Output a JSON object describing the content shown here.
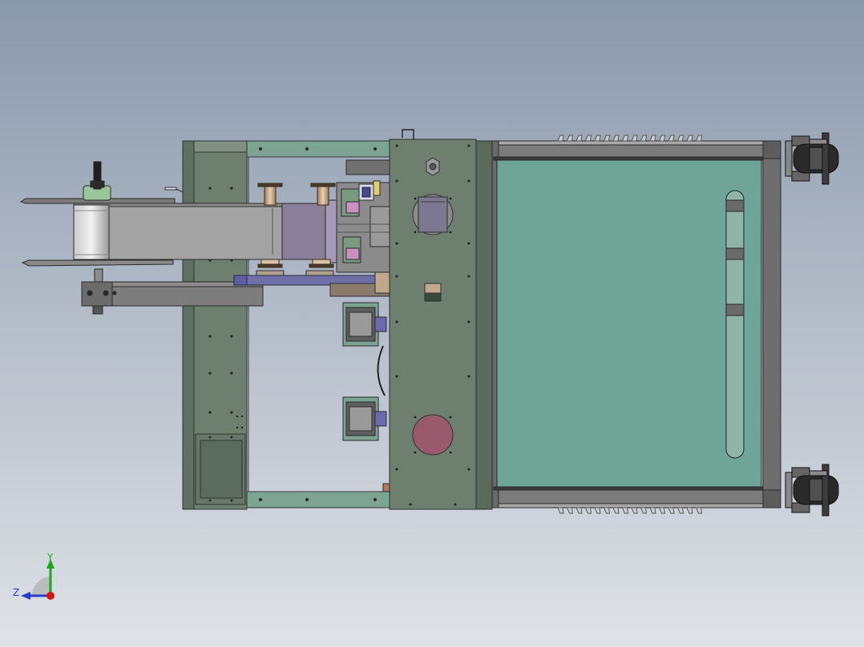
{
  "viewport": {
    "background_top": "#8a98ab",
    "background_bottom": "#dfe2e7"
  },
  "colors": {
    "frame": "#6e7f70",
    "frame_dark": "#3f4a42",
    "rail_green": "#7da393",
    "panel_teal": "#6ea596",
    "steel": "#7d7d7d",
    "steel_dark": "#555555",
    "grey_belt": "#a3a3a3",
    "purple": "#8a7f98",
    "blue_purple": "#7070a8",
    "tan": "#b0a08a",
    "maroon_disc": "#9a5a6e",
    "caster_black": "#2a2a2a"
  },
  "icons": {
    "triad": "coordinate-triad-icon",
    "caster": "caster-wheel-icon"
  },
  "triad": {
    "y_label": "Y",
    "z_label": "Z",
    "y_color": "#1fa51f",
    "z_color": "#2a3ad0",
    "origin_color": "#d01616"
  }
}
